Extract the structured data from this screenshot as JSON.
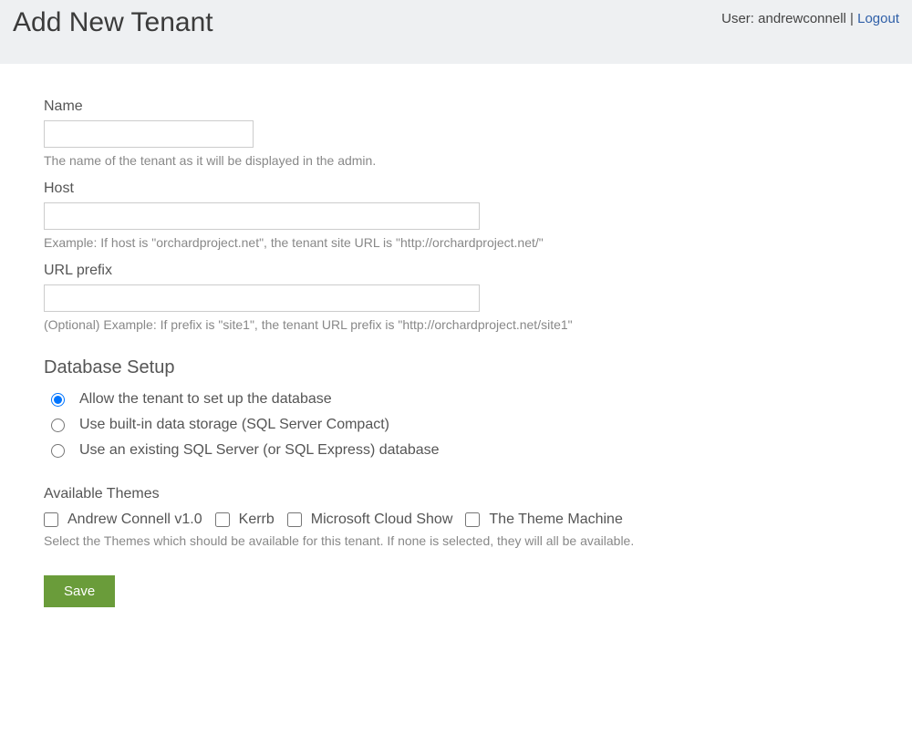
{
  "header": {
    "title": "Add New Tenant",
    "user_prefix": "User: ",
    "username": "andrewconnell",
    "separator": " | ",
    "logout": "Logout"
  },
  "fields": {
    "name": {
      "label": "Name",
      "value": "",
      "hint": "The name of the tenant as it will be displayed in the admin."
    },
    "host": {
      "label": "Host",
      "value": "",
      "hint": "Example: If host is \"orchardproject.net\", the tenant site URL is \"http://orchardproject.net/\""
    },
    "url_prefix": {
      "label": "URL prefix",
      "value": "",
      "hint": "(Optional) Example: If prefix is \"site1\", the tenant URL prefix is \"http://orchardproject.net/site1\""
    }
  },
  "database": {
    "heading": "Database Setup",
    "options": [
      "Allow the tenant to set up the database",
      "Use built-in data storage (SQL Server Compact)",
      "Use an existing SQL Server (or SQL Express) database"
    ],
    "selected": 0
  },
  "themes": {
    "label": "Available Themes",
    "items": [
      "Andrew Connell v1.0",
      "Kerrb",
      "Microsoft Cloud Show",
      "The Theme Machine"
    ],
    "hint": "Select the Themes which should be available for this tenant. If none is selected, they will all be available."
  },
  "actions": {
    "save": "Save"
  }
}
